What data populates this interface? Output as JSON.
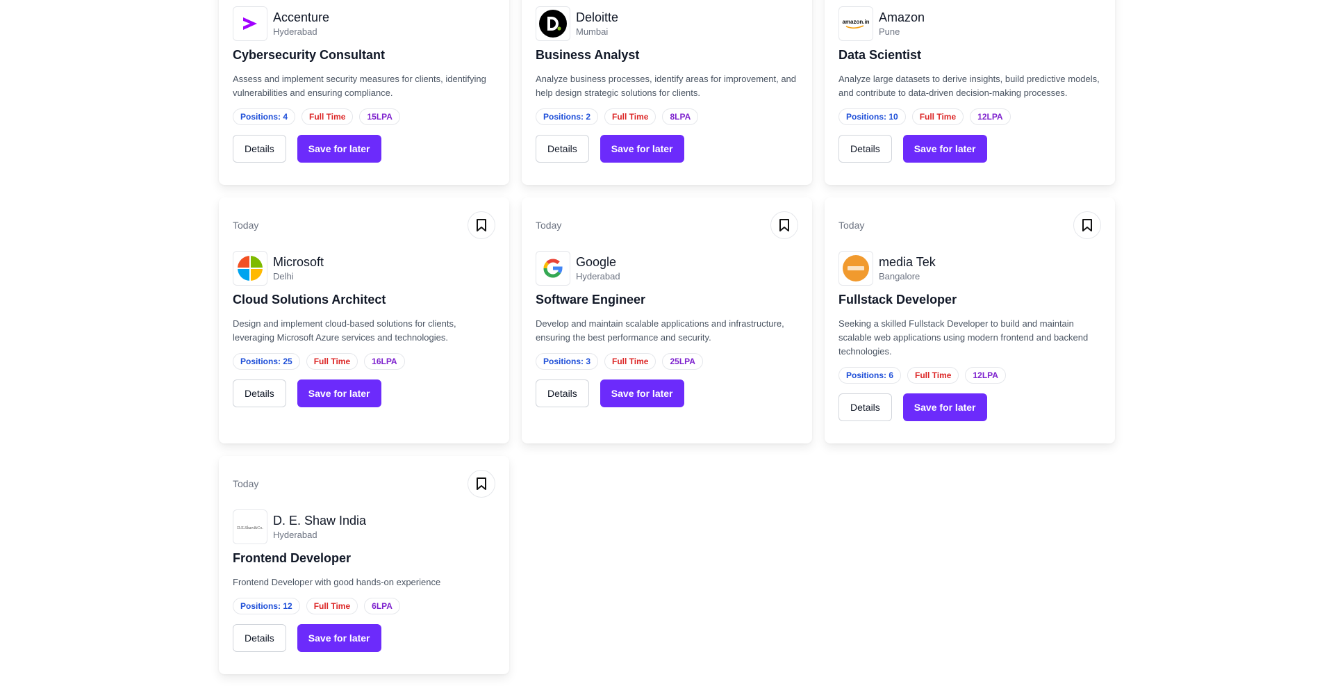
{
  "colors": {
    "accent": "#6c2bfb",
    "positions": "#1d4ed8",
    "type": "#dc2626",
    "salary": "#7e22ce"
  },
  "jobs": [
    {
      "date": "",
      "company": "Accenture",
      "location": "Hyderabad",
      "title": "Cybersecurity Consultant",
      "description": "Assess and implement security measures for clients, identifying vulnerabilities and ensuring compliance.",
      "positions": "Positions: 4",
      "type": "Full Time",
      "salary": "15LPA",
      "details": "Details",
      "save": "Save for later"
    },
    {
      "date": "",
      "company": "Deloitte",
      "location": "Mumbai",
      "title": "Business Analyst",
      "description": "Analyze business processes, identify areas for improvement, and help design strategic solutions for clients.",
      "positions": "Positions: 2",
      "type": "Full Time",
      "salary": "8LPA",
      "details": "Details",
      "save": "Save for later"
    },
    {
      "date": "",
      "company": "Amazon",
      "location": "Pune",
      "title": "Data Scientist",
      "description": "Analyze large datasets to derive insights, build predictive models, and contribute to data-driven decision-making processes.",
      "positions": "Positions: 10",
      "type": "Full Time",
      "salary": "12LPA",
      "details": "Details",
      "save": "Save for later",
      "logo_text": "amazon.in"
    },
    {
      "date": "Today",
      "company": "Microsoft",
      "location": "Delhi",
      "title": "Cloud Solutions Architect",
      "description": "Design and implement cloud-based solutions for clients, leveraging Microsoft Azure services and technologies.",
      "positions": "Positions: 25",
      "type": "Full Time",
      "salary": "16LPA",
      "details": "Details",
      "save": "Save for later"
    },
    {
      "date": "Today",
      "company": "Google",
      "location": "Hyderabad",
      "title": "Software Engineer",
      "description": "Develop and maintain scalable applications and infrastructure, ensuring the best performance and security.",
      "positions": "Positions: 3",
      "type": "Full Time",
      "salary": "25LPA",
      "details": "Details",
      "save": "Save for later"
    },
    {
      "date": "Today",
      "company": "media Tek",
      "location": "Bangalore",
      "title": "Fullstack Developer",
      "description": "Seeking a skilled Fullstack Developer to build and maintain scalable web applications using modern frontend and backend technologies.",
      "positions": "Positions: 6",
      "type": "Full Time",
      "salary": "12LPA",
      "details": "Details",
      "save": "Save for later"
    },
    {
      "date": "Today",
      "company": "D. E. Shaw India",
      "location": "Hyderabad",
      "title": "Frontend Developer",
      "description": "Frontend Developer with good hands-on experience",
      "positions": "Positions: 12",
      "type": "Full Time",
      "salary": "6LPA",
      "details": "Details",
      "save": "Save for later",
      "logo_text": "D.E.Shaw&Co."
    }
  ]
}
